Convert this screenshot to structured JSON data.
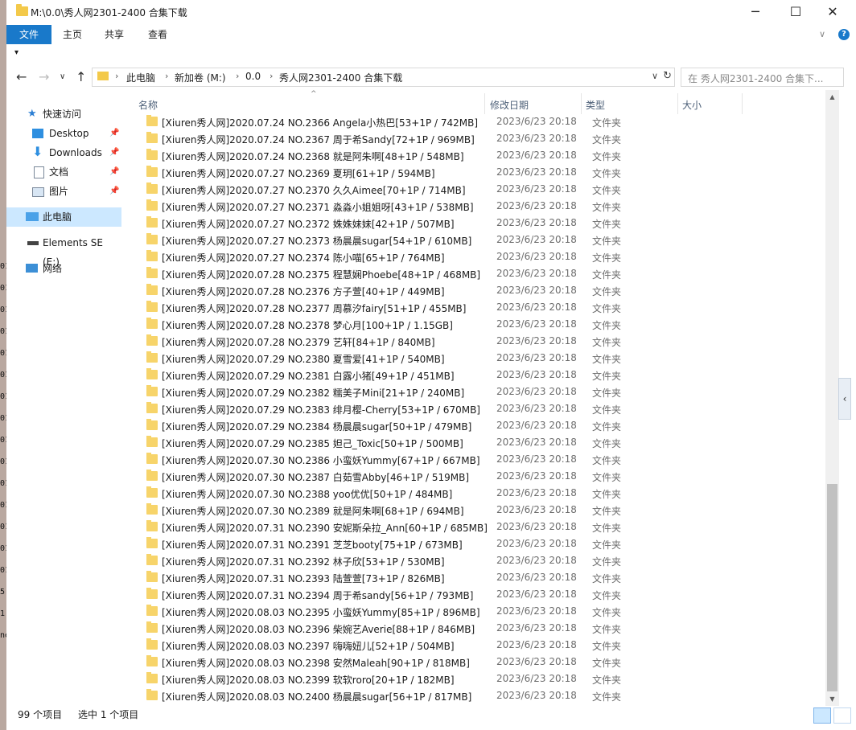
{
  "window": {
    "title": "M:\\0.0\\秀人网2301-2400 合集下载"
  },
  "window_buttons": {
    "minimize": "─",
    "maximize": "☐",
    "close": "✕"
  },
  "ribbon": {
    "file": "文件",
    "tabs": [
      "主页",
      "共享",
      "查看"
    ],
    "expand": "∨",
    "help": "?"
  },
  "quick_access_toggle": "▾",
  "nav_buttons": {
    "back": "←",
    "forward": "→",
    "dropdown": "∨",
    "up": "↑"
  },
  "address": {
    "crumbs": [
      "此电脑",
      "新加卷 (M:)",
      "0.0",
      "秀人网2301-2400 合集下载"
    ],
    "separator": "›",
    "dropdown": "∨",
    "refresh": "↻"
  },
  "search": {
    "placeholder": "在 秀人网2301-2400 合集下..."
  },
  "sidebar": {
    "quick_access": "快速访问",
    "items": [
      {
        "label": "Desktop",
        "icon": "desktop-icon"
      },
      {
        "label": "Downloads",
        "icon": "download-icon"
      },
      {
        "label": "文档",
        "icon": "document-icon"
      },
      {
        "label": "图片",
        "icon": "picture-icon"
      }
    ],
    "this_pc": "此电脑",
    "drive": "Elements SE (E:)",
    "network": "网络",
    "pin": "📌"
  },
  "columns": {
    "name": "名称",
    "date": "修改日期",
    "type": "类型",
    "size": "大小",
    "sort_indicator": "^"
  },
  "files": [
    "[Xiuren秀人网]2020.07.24 NO.2366 Angela小热巴[53+1P / 742MB]",
    "[Xiuren秀人网]2020.07.24 NO.2367 周于希Sandy[72+1P / 969MB]",
    "[Xiuren秀人网]2020.07.24 NO.2368 就是阿朱啊[48+1P / 548MB]",
    "[Xiuren秀人网]2020.07.27 NO.2369 夏玥[61+1P / 594MB]",
    "[Xiuren秀人网]2020.07.27 NO.2370 久久Aimee[70+1P / 714MB]",
    "[Xiuren秀人网]2020.07.27 NO.2371 淼淼小姐姐呀[43+1P / 538MB]",
    "[Xiuren秀人网]2020.07.27 NO.2372 姝姝妹妹[42+1P / 507MB]",
    "[Xiuren秀人网]2020.07.27 NO.2373 杨晨晨sugar[54+1P / 610MB]",
    "[Xiuren秀人网]2020.07.27 NO.2374 陈小喵[65+1P / 764MB]",
    "[Xiuren秀人网]2020.07.28 NO.2375 程慧娴Phoebe[48+1P / 468MB]",
    "[Xiuren秀人网]2020.07.28 NO.2376 方子萱[40+1P / 449MB]",
    "[Xiuren秀人网]2020.07.28 NO.2377 周慕汐fairy[51+1P / 455MB]",
    "[Xiuren秀人网]2020.07.28 NO.2378 梦心月[100+1P / 1.15GB]",
    "[Xiuren秀人网]2020.07.28 NO.2379 艺轩[84+1P / 840MB]",
    "[Xiuren秀人网]2020.07.29 NO.2380 夏雪爱[41+1P / 540MB]",
    "[Xiuren秀人网]2020.07.29 NO.2381 白露小猪[49+1P / 451MB]",
    "[Xiuren秀人网]2020.07.29 NO.2382 糯美子Mini[21+1P / 240MB]",
    "[Xiuren秀人网]2020.07.29 NO.2383 绯月樱-Cherry[53+1P / 670MB]",
    "[Xiuren秀人网]2020.07.29 NO.2384 杨晨晨sugar[50+1P / 479MB]",
    "[Xiuren秀人网]2020.07.29 NO.2385 妲己_Toxic[50+1P / 500MB]",
    "[Xiuren秀人网]2020.07.30 NO.2386 小蛮妖Yummy[67+1P / 667MB]",
    "[Xiuren秀人网]2020.07.30 NO.2387 白茹雪Abby[46+1P / 519MB]",
    "[Xiuren秀人网]2020.07.30 NO.2388 yoo优优[50+1P / 484MB]",
    "[Xiuren秀人网]2020.07.30 NO.2389 就是阿朱啊[68+1P / 694MB]",
    "[Xiuren秀人网]2020.07.31 NO.2390 安妮斯朵拉_Ann[60+1P / 685MB]",
    "[Xiuren秀人网]2020.07.31 NO.2391 芝芝booty[75+1P / 673MB]",
    "[Xiuren秀人网]2020.07.31 NO.2392 林子欣[53+1P / 530MB]",
    "[Xiuren秀人网]2020.07.31 NO.2393 陆萱萱[73+1P / 826MB]",
    "[Xiuren秀人网]2020.07.31 NO.2394 周于希sandy[56+1P / 793MB]",
    "[Xiuren秀人网]2020.08.03 NO.2395 小蛮妖Yummy[85+1P / 896MB]",
    "[Xiuren秀人网]2020.08.03 NO.2396 柴婉艺Averie[88+1P / 846MB]",
    "[Xiuren秀人网]2020.08.03 NO.2397 嗨嗨妞儿[52+1P / 504MB]",
    "[Xiuren秀人网]2020.08.03 NO.2398 安然Maleah[90+1P / 818MB]",
    "[Xiuren秀人网]2020.08.03 NO.2399 软软roro[20+1P / 182MB]",
    "[Xiuren秀人网]2020.08.03 NO.2400 杨晨晨sugar[56+1P / 817MB]"
  ],
  "file_date": "2023/6/23 20:18",
  "file_type": "文件夹",
  "status": {
    "count": "99 个项目",
    "selected": "选中 1 个项目"
  },
  "scrollbar": {
    "up": "▲",
    "down": "▼",
    "position": 0.74
  },
  "side_toggle": "‹",
  "left_edge_chars": [
    "01",
    "01",
    "01",
    "01",
    "01",
    "01",
    "01",
    "01",
    "01",
    "01",
    "01",
    "01",
    "01",
    "01",
    "01",
    "5",
    "1",
    "ne"
  ],
  "colors": {
    "accent": "#1979ca",
    "folder": "#f3c94a",
    "selection": "#cce8ff"
  }
}
